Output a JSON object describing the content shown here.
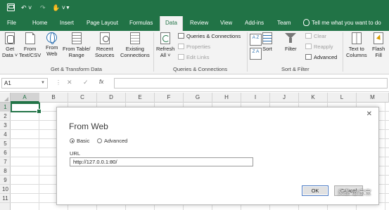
{
  "quick_access": {
    "icons": [
      "save-icon",
      "undo-icon",
      "redo-icon",
      "touch-mode-icon",
      "customize-icon"
    ]
  },
  "tabs": [
    "File",
    "Home",
    "Insert",
    "Page Layout",
    "Formulas",
    "Data",
    "Review",
    "View",
    "Add-ins",
    "Team"
  ],
  "active_tab": "Data",
  "tell_me": "Tell me what you want to do",
  "ribbon": {
    "get_transform": {
      "buttons": [
        {
          "line1": "Get",
          "line2": "Data ˅",
          "icon": "database-icon"
        },
        {
          "line1": "From",
          "line2": "Text/CSV",
          "icon": "text-file-icon"
        },
        {
          "line1": "From",
          "line2": "Web",
          "icon": "web-icon"
        },
        {
          "line1": "From Table/",
          "line2": "Range",
          "icon": "table-icon"
        },
        {
          "line1": "Recent",
          "line2": "Sources",
          "icon": "recent-sources-icon"
        },
        {
          "line1": "Existing",
          "line2": "Connections",
          "icon": "connections-icon"
        }
      ],
      "group_label": "Get & Transform Data"
    },
    "queries": {
      "refresh_line1": "Refresh",
      "refresh_line2": "All ˅",
      "items": [
        "Queries & Connections",
        "Properties",
        "Edit Links"
      ],
      "group_label": "Queries & Connections"
    },
    "sort_filter": {
      "sort_az_top": "A Z",
      "sort_az_bottom": "Z A",
      "sort_label": "Sort",
      "filter_label": "Filter",
      "clear": "Clear",
      "reapply": "Reapply",
      "advanced": "Advanced",
      "group_label": "Sort & Filter"
    },
    "data_tools": {
      "text_to_columns_line1": "Text to",
      "text_to_columns_line2": "Columns",
      "flash_fill_line1": "Flash",
      "flash_fill_line2": "Fill"
    }
  },
  "formula_bar": {
    "name_box": "A1",
    "cancel": "✕",
    "enter": "✓",
    "fx": "fx",
    "formula": ""
  },
  "grid": {
    "columns": [
      "A",
      "B",
      "C",
      "D",
      "E",
      "F",
      "G",
      "H",
      "I",
      "J",
      "K",
      "L",
      "M"
    ],
    "rows": [
      "1",
      "2",
      "3",
      "4",
      "5",
      "6",
      "7",
      "8",
      "9",
      "10",
      "11"
    ],
    "selected_cell": "A1"
  },
  "dialog": {
    "title": "From Web",
    "close": "✕",
    "radio_basic": "Basic",
    "radio_advanced": "Advanced",
    "selected_mode": "Basic",
    "url_label": "URL",
    "url_value": "http://127.0.0.1:80/",
    "ok": "OK",
    "cancel": "Cancel"
  },
  "watermark": "头条 @宝宝"
}
